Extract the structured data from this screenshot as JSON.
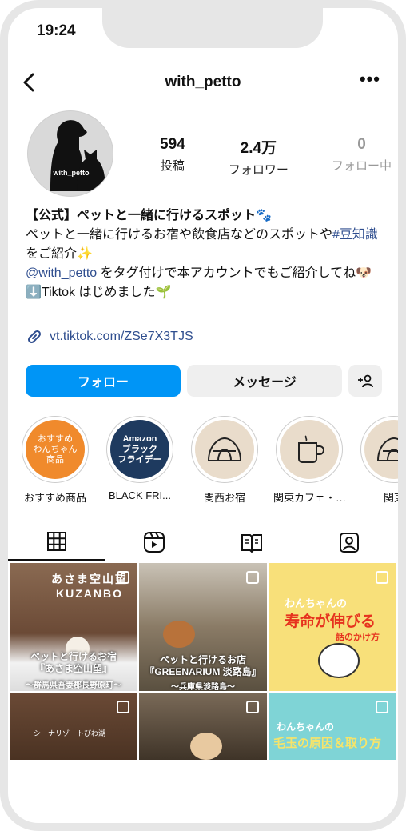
{
  "status": {
    "time": "19:24"
  },
  "profile": {
    "username": "with_petto",
    "avatar_text": "with_petto",
    "stats": [
      {
        "num": "594",
        "label": "投稿"
      },
      {
        "num": "2.4万",
        "label": "フォロワー"
      },
      {
        "num": "0",
        "label": "フォロー中"
      }
    ],
    "bio": {
      "name": "【公式】ペットと一緒に行けるスポット🐾",
      "line1": "ペットと一緒に行けるお宿や飲食店などのスポットや",
      "hashtag": "#豆知識",
      "line1_end": " をご紹介✨",
      "mention": "@with_petto",
      "line2": " をタグ付けで本アカウントでもご紹介してね🐶",
      "line3": "⬇️Tiktok はじめました🌱"
    },
    "link": "vt.tiktok.com/ZSe7X3TJS"
  },
  "actions": {
    "follow": "フォロー",
    "message": "メッセージ",
    "add": "+8"
  },
  "highlights": [
    {
      "label": "おすすめ商品",
      "inner": "おすすめ\nわんちゃん\n商品",
      "color": "#f08a2c"
    },
    {
      "label": "BLACK FRI...",
      "inner": "Amazon\nブラック\nフライデー",
      "color": "#1e3a5f"
    },
    {
      "label": "関西お宿",
      "icon": "tent-icon",
      "color": "#e9dccb"
    },
    {
      "label": "関東カフェ・…",
      "icon": "mug-icon",
      "color": "#e9dccb"
    },
    {
      "label": "関東",
      "icon": "tent-icon",
      "color": "#e9dccb"
    }
  ],
  "posts": [
    {
      "title": "ペットと行けるお宿\n『あさま空山望』",
      "sub": "〜群馬県吾妻郡長野原町〜",
      "sign": "あさま空山望 KUZANBO"
    },
    {
      "title": "ペットと行けるお店\n『GREENARIUM 淡路島』",
      "sub": "〜兵庫県淡路島〜"
    },
    {
      "title": "わんちゃんの",
      "highlight": "寿命が伸びる",
      "sub": "話のかけ方"
    },
    {
      "title": "シーナリゾートびわ湖"
    },
    {
      "title": ""
    },
    {
      "title": "わんちゃんの",
      "highlight": "毛玉の原因＆取り方"
    }
  ]
}
